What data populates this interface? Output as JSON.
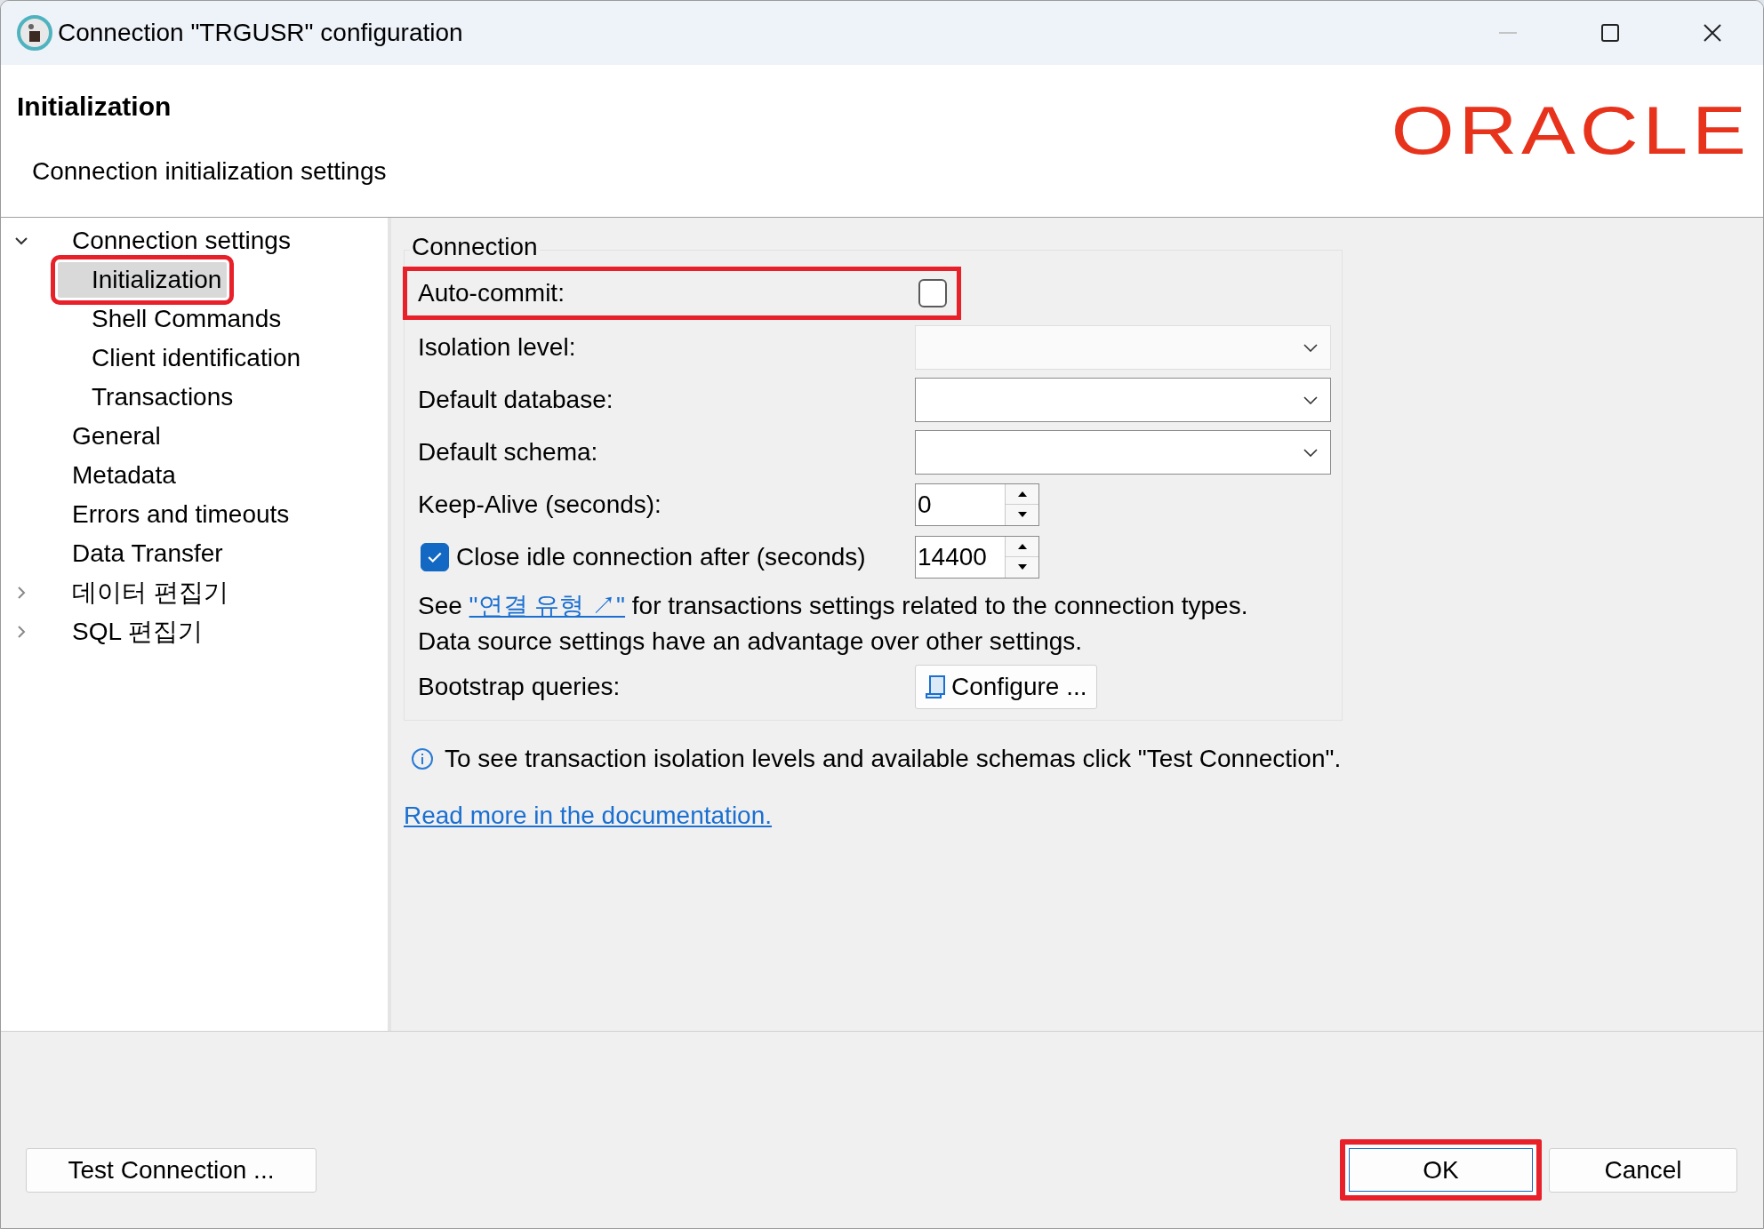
{
  "window": {
    "title": "Connection \"TRGUSR\" configuration",
    "minimize_disabled": true
  },
  "header": {
    "title": "Initialization",
    "subtitle": "Connection initialization settings",
    "logo": "ORACLE"
  },
  "tree": [
    {
      "label": "Connection settings",
      "expanded": true,
      "selected": false,
      "highlighted": false,
      "children": [
        {
          "label": "Initialization",
          "selected": true,
          "highlighted": true
        },
        {
          "label": "Shell Commands",
          "selected": false,
          "highlighted": false
        },
        {
          "label": "Client identification",
          "selected": false,
          "highlighted": false
        },
        {
          "label": "Transactions",
          "selected": false,
          "highlighted": false
        }
      ]
    },
    {
      "label": "General",
      "selected": false,
      "highlighted": false
    },
    {
      "label": "Metadata",
      "selected": false,
      "highlighted": false
    },
    {
      "label": "Errors and timeouts",
      "selected": false,
      "highlighted": false
    },
    {
      "label": "Data Transfer",
      "selected": false,
      "highlighted": false
    },
    {
      "label": "데이터 편집기",
      "expanded": false,
      "selected": false,
      "highlighted": false
    },
    {
      "label": "SQL 편집기",
      "expanded": false,
      "selected": false,
      "highlighted": false
    }
  ],
  "connection_group": {
    "title": "Connection",
    "fields": [
      {
        "kind": "checkbox",
        "label": "Auto-commit:",
        "checked": false,
        "highlighted": true
      },
      {
        "kind": "dropdown",
        "label": "Isolation level:",
        "disabled": true,
        "highlighted": false
      },
      {
        "kind": "dropdown",
        "label": "Default database:",
        "disabled": false,
        "highlighted": false
      },
      {
        "kind": "dropdown",
        "label": "Default schema:",
        "disabled": false,
        "highlighted": false
      },
      {
        "kind": "spinner",
        "label": "Keep-Alive (seconds):",
        "value": "0",
        "highlighted": false
      },
      {
        "kind": "check-spinner",
        "label": "Close idle connection after (seconds)",
        "checked": true,
        "value": "14400",
        "highlighted": false
      }
    ],
    "note": {
      "before": "See ",
      "link": "\"연결 유형 ↗\"",
      "after": " for transactions settings related to the connection types."
    },
    "note_2": "Data source settings have an advantage over other settings.",
    "bootstrap": {
      "label": "Bootstrap queries:",
      "button": "Configure ..."
    }
  },
  "info": "To see transaction isolation levels and available schemas click \"Test Connection\".",
  "doc_link": "Read more in the documentation.",
  "buttons": [
    {
      "kind": "left",
      "label": "Test Connection ...",
      "highlighted": false
    },
    {
      "kind": "right",
      "label": "OK",
      "highlighted": true
    },
    {
      "kind": "right",
      "label": "Cancel",
      "highlighted": false
    }
  ]
}
